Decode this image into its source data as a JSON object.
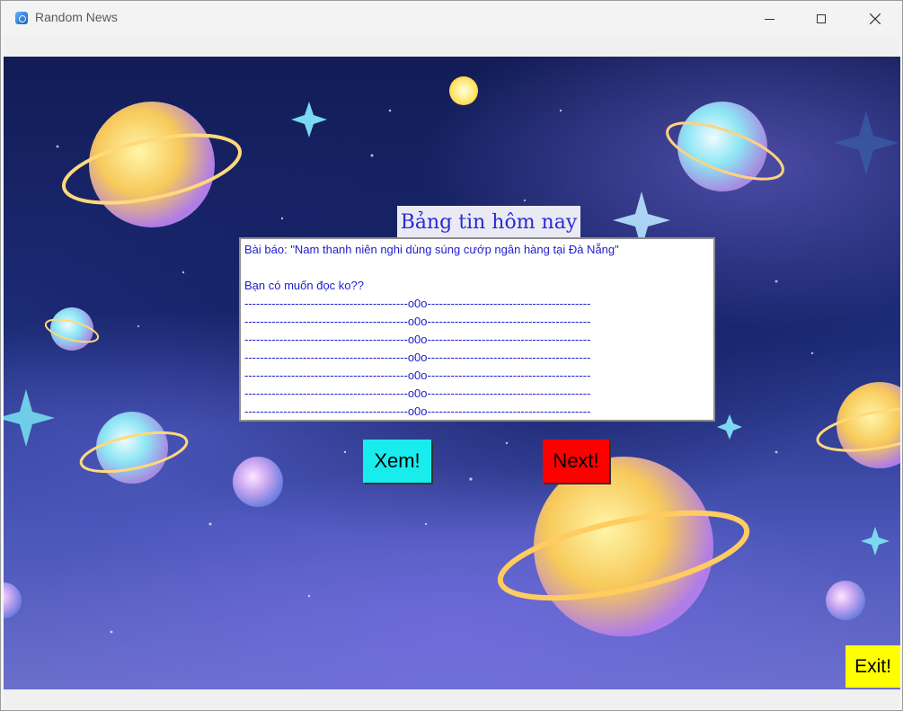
{
  "window": {
    "title": "Random News"
  },
  "heading": "Bảng tin hôm nay",
  "news": {
    "line1": "Bài báo: \"Nam thanh niên nghi dùng súng cướp ngân hàng tại Đà Nẵng\"",
    "line2": "",
    "line3": "Bạn có muốn đọc ko??",
    "separator": "------------------------------------------o0o------------------------------------------",
    "separator_count": 7
  },
  "buttons": {
    "xem": "Xem!",
    "next": "Next!",
    "exit": "Exit!"
  },
  "colors": {
    "xem": "#19ecec",
    "next": "#ff0000",
    "exit": "#ffff00",
    "text": "#2020d0"
  },
  "icons": {
    "app": "app-icon",
    "minimize": "minimize-icon",
    "maximize": "maximize-icon",
    "close": "close-icon"
  }
}
